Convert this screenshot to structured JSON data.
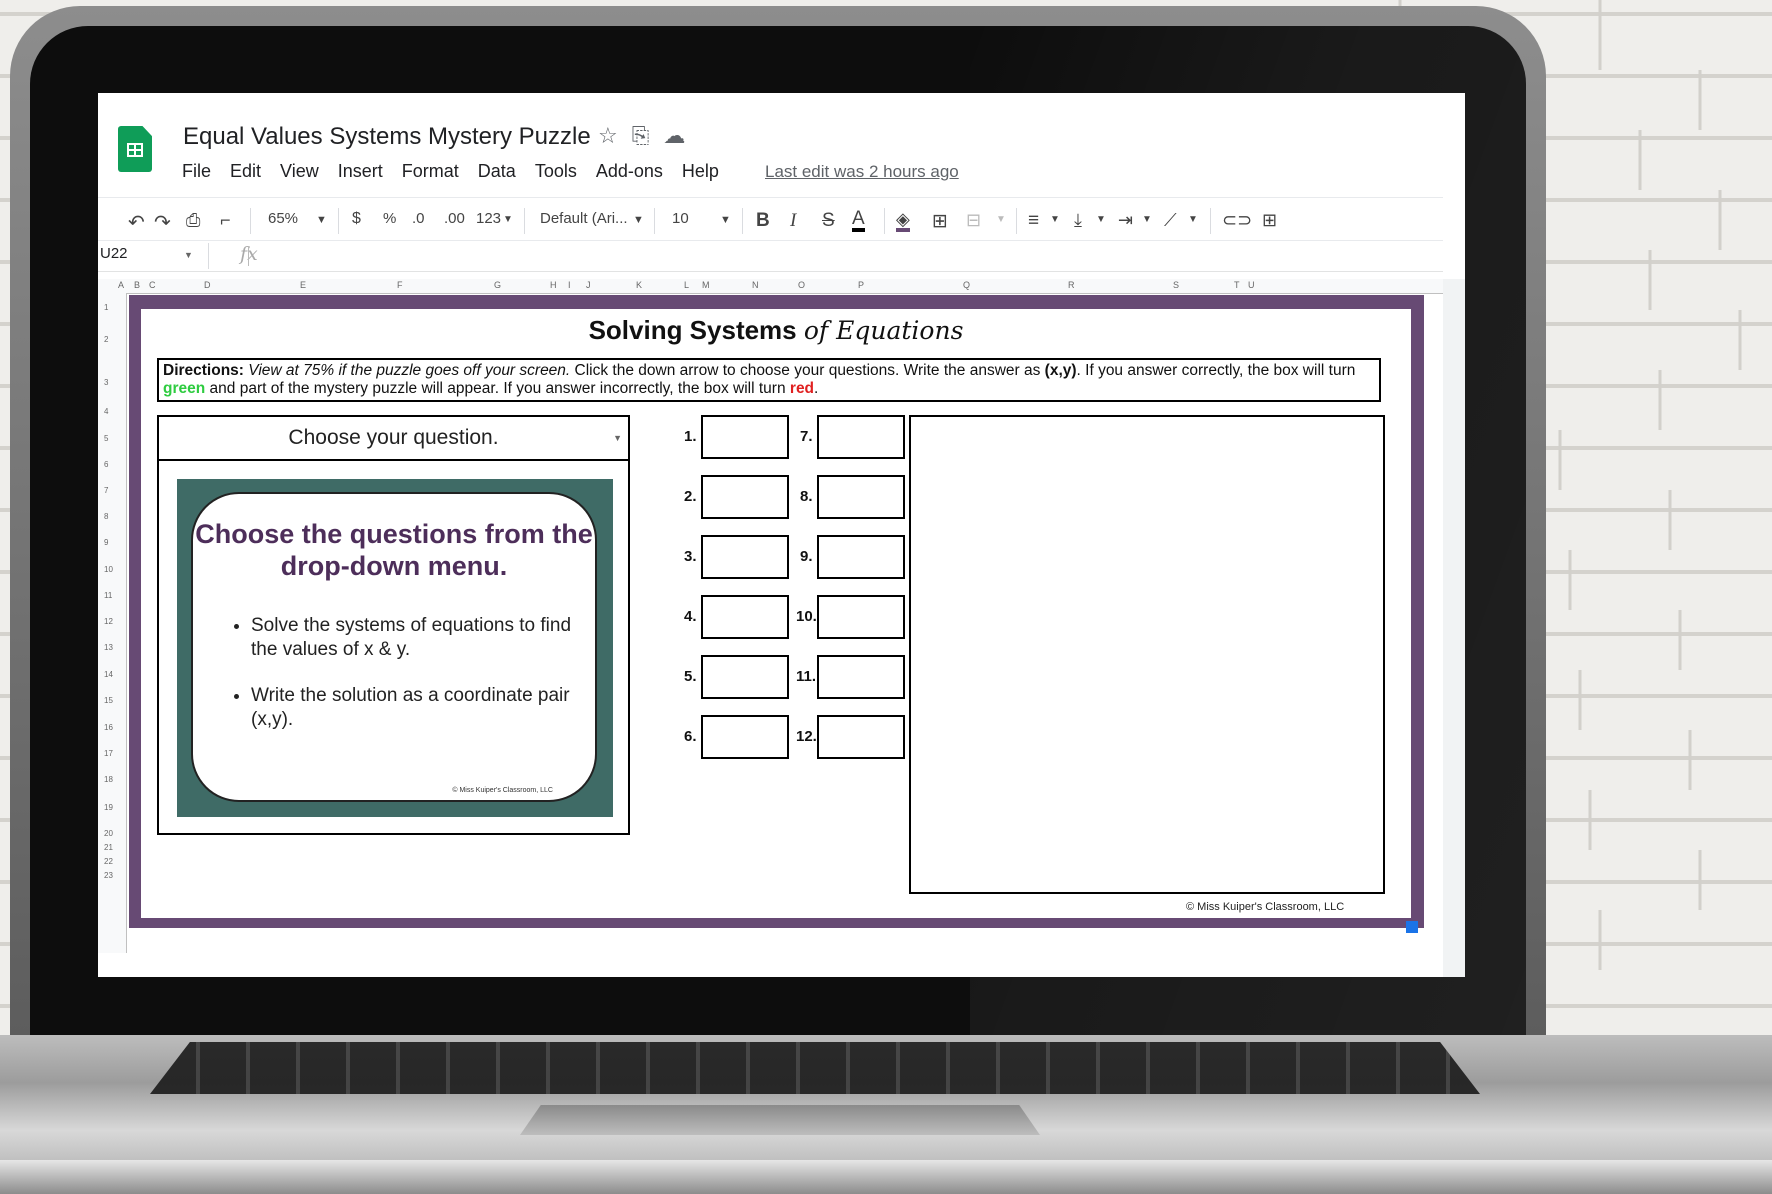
{
  "app": {
    "doc_title": "Equal Values Systems Mystery Puzzle",
    "title_icons": [
      "star-icon",
      "move-to-folder-icon",
      "cloud-saved-icon"
    ],
    "menu": [
      "File",
      "Edit",
      "View",
      "Insert",
      "Format",
      "Data",
      "Tools",
      "Add-ons",
      "Help"
    ],
    "last_edit": "Last edit was 2 hours ago"
  },
  "toolbar": {
    "zoom": "65%",
    "currency": "$",
    "percent": "%",
    "decrease_decimal": ".0",
    "increase_decimal": ".00",
    "number_format": "123",
    "font": "Default (Ari...",
    "font_size": "10",
    "bold": "B",
    "italic": "I",
    "strike": "S",
    "text_color": "A"
  },
  "formula_bar": {
    "cell_ref": "U22",
    "fx": "fx"
  },
  "columns": [
    "A",
    "B",
    "C",
    "D",
    "E",
    "F",
    "G",
    "H",
    "I",
    "J",
    "K",
    "L",
    "M",
    "N",
    "O",
    "P",
    "Q",
    "R",
    "S",
    "T",
    "U"
  ],
  "rows": [
    "1",
    "2",
    "3",
    "4",
    "5",
    "6",
    "7",
    "8",
    "9",
    "10",
    "11",
    "12",
    "13",
    "14",
    "15",
    "16",
    "17",
    "18",
    "19",
    "20",
    "21",
    "22",
    "23"
  ],
  "puzzle": {
    "title_main": "Solving Systems",
    "title_script": "of Equations",
    "directions_label": "Directions:",
    "directions_italic": "View at 75% if the puzzle goes off your screen.",
    "directions_text1": "Click the down arrow to choose your questions. Write the answer as",
    "directions_bold": "(x,y)",
    "directions_text2": ". If you answer correctly, the box will turn",
    "green_word": "green",
    "directions_text3": "and part of the mystery puzzle will appear. If you answer incorrectly, the box will turn",
    "red_word": "red",
    "period": ".",
    "question_select": "Choose your question.",
    "card_heading": "Choose the questions from the drop-down menu.",
    "card_bullets": [
      "Solve the systems of equations to find the values of x & y.",
      "Write the solution as a coordinate pair (x,y)."
    ],
    "card_copyright": "© Miss Kuiper's Classroom, LLC",
    "answer_labels": [
      "1.",
      "2.",
      "3.",
      "4.",
      "5.",
      "6.",
      "7.",
      "8.",
      "9.",
      "10.",
      "11.",
      "12."
    ],
    "copyright": "© Miss Kuiper's Classroom, LLC"
  },
  "colors": {
    "frame": "#674a74",
    "card_bg": "#3f6b66",
    "heading": "#4d2e5a",
    "sheets_green": "#0f9d58",
    "correct": "#2ecc40",
    "incorrect": "#e02020"
  }
}
